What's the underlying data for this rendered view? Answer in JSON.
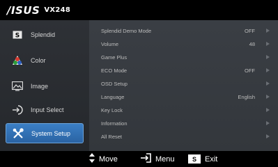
{
  "header": {
    "brand": "/ISUS",
    "model": "VX248"
  },
  "sidebar": {
    "items": [
      {
        "label": "Splendid",
        "icon": "s-key-icon",
        "active": false
      },
      {
        "label": "Color",
        "icon": "color-triangle-icon",
        "active": false
      },
      {
        "label": "Image",
        "icon": "image-icon",
        "active": false
      },
      {
        "label": "Input Select",
        "icon": "input-select-icon",
        "active": false
      },
      {
        "label": "System Setup",
        "icon": "tools-icon",
        "active": true
      }
    ]
  },
  "menu": {
    "rows": [
      {
        "label": "Splendid Demo Mode",
        "value": "OFF"
      },
      {
        "label": "Volume",
        "value": "48"
      },
      {
        "label": "Game Plus",
        "value": ""
      },
      {
        "label": "ECO Mode",
        "value": "OFF"
      },
      {
        "label": "OSD Setup",
        "value": ""
      },
      {
        "label": "Language",
        "value": "English"
      },
      {
        "label": "Key Lock",
        "value": ""
      },
      {
        "label": "Information",
        "value": ""
      },
      {
        "label": "All Reset",
        "value": ""
      }
    ]
  },
  "footer": {
    "move_label": "Move",
    "menu_label": "Menu",
    "exit_key": "S",
    "exit_label": "Exit"
  },
  "colors": {
    "accent": "#2f6fb3",
    "panel": "#383c42",
    "sidebar": "#2a2d31"
  }
}
